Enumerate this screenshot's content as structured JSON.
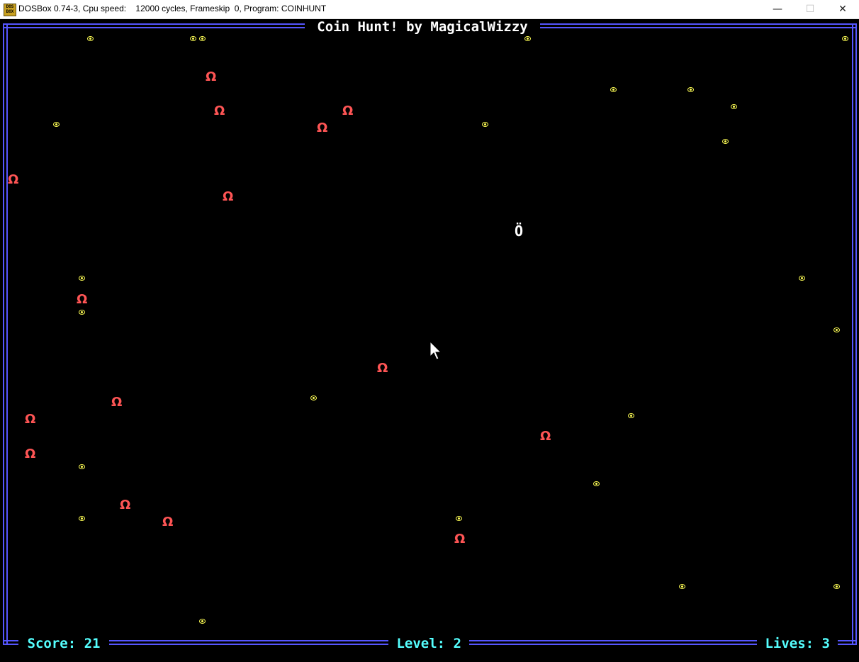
{
  "window": {
    "title": "DOSBox 0.74-3, Cpu speed:    12000 cycles, Frameskip  0, Program: COINHUNT",
    "icon_text": "DOS BOX",
    "minimize": "—",
    "maximize": "☐",
    "close": "✕"
  },
  "game": {
    "title": " Coin Hunt! by MagicalWizzy ",
    "score_text": " Score: 21 ",
    "level_text": " Level: 2 ",
    "lives_text": " Lives: 3 ",
    "score": 21,
    "level": 2,
    "lives": 3,
    "player_glyph": "Ö",
    "enemy_glyph": "Ω",
    "colors": {
      "background": "#000000",
      "border": "#5656ff",
      "hud": "#55ffff",
      "coin": "#ffff55",
      "enemy": "#ff5555",
      "player": "#ffffff"
    }
  }
}
